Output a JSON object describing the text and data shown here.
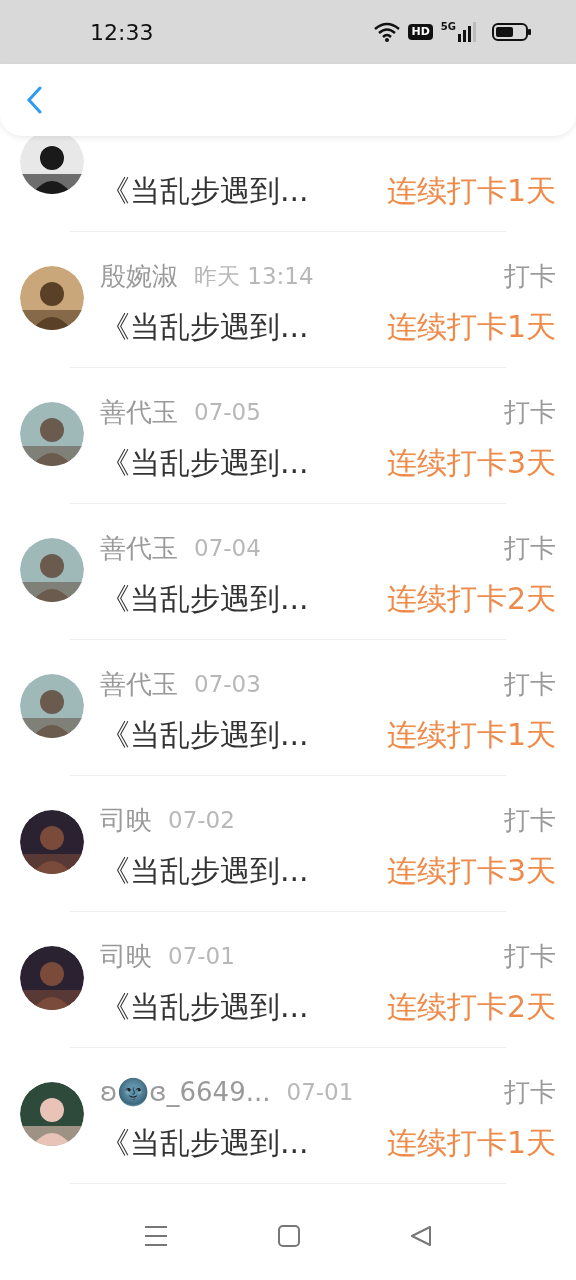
{
  "status_bar": {
    "time": "12:33",
    "hd_label": "HD",
    "network_label": "5G"
  },
  "entries": [
    {
      "title": "《当乱步遇到...",
      "streak": "连续打卡1天"
    },
    {
      "name": "殷婉淑",
      "time": "昨天 13:14",
      "action": "打卡",
      "title": "《当乱步遇到...",
      "streak": "连续打卡1天"
    },
    {
      "name": "善代玉",
      "time": "07-05",
      "action": "打卡",
      "title": "《当乱步遇到...",
      "streak": "连续打卡3天"
    },
    {
      "name": "善代玉",
      "time": "07-04",
      "action": "打卡",
      "title": "《当乱步遇到...",
      "streak": "连续打卡2天"
    },
    {
      "name": "善代玉",
      "time": "07-03",
      "action": "打卡",
      "title": "《当乱步遇到...",
      "streak": "连续打卡1天"
    },
    {
      "name": "司映",
      "time": "07-02",
      "action": "打卡",
      "title": "《当乱步遇到...",
      "streak": "连续打卡3天"
    },
    {
      "name": "司映",
      "time": "07-01",
      "action": "打卡",
      "title": "《当乱步遇到...",
      "streak": "连续打卡2天"
    },
    {
      "name": "ʚ🌚ɞ_6649...",
      "time": "07-01",
      "action": "打卡",
      "title": "《当乱步遇到...",
      "streak": "连续打卡1天"
    }
  ]
}
